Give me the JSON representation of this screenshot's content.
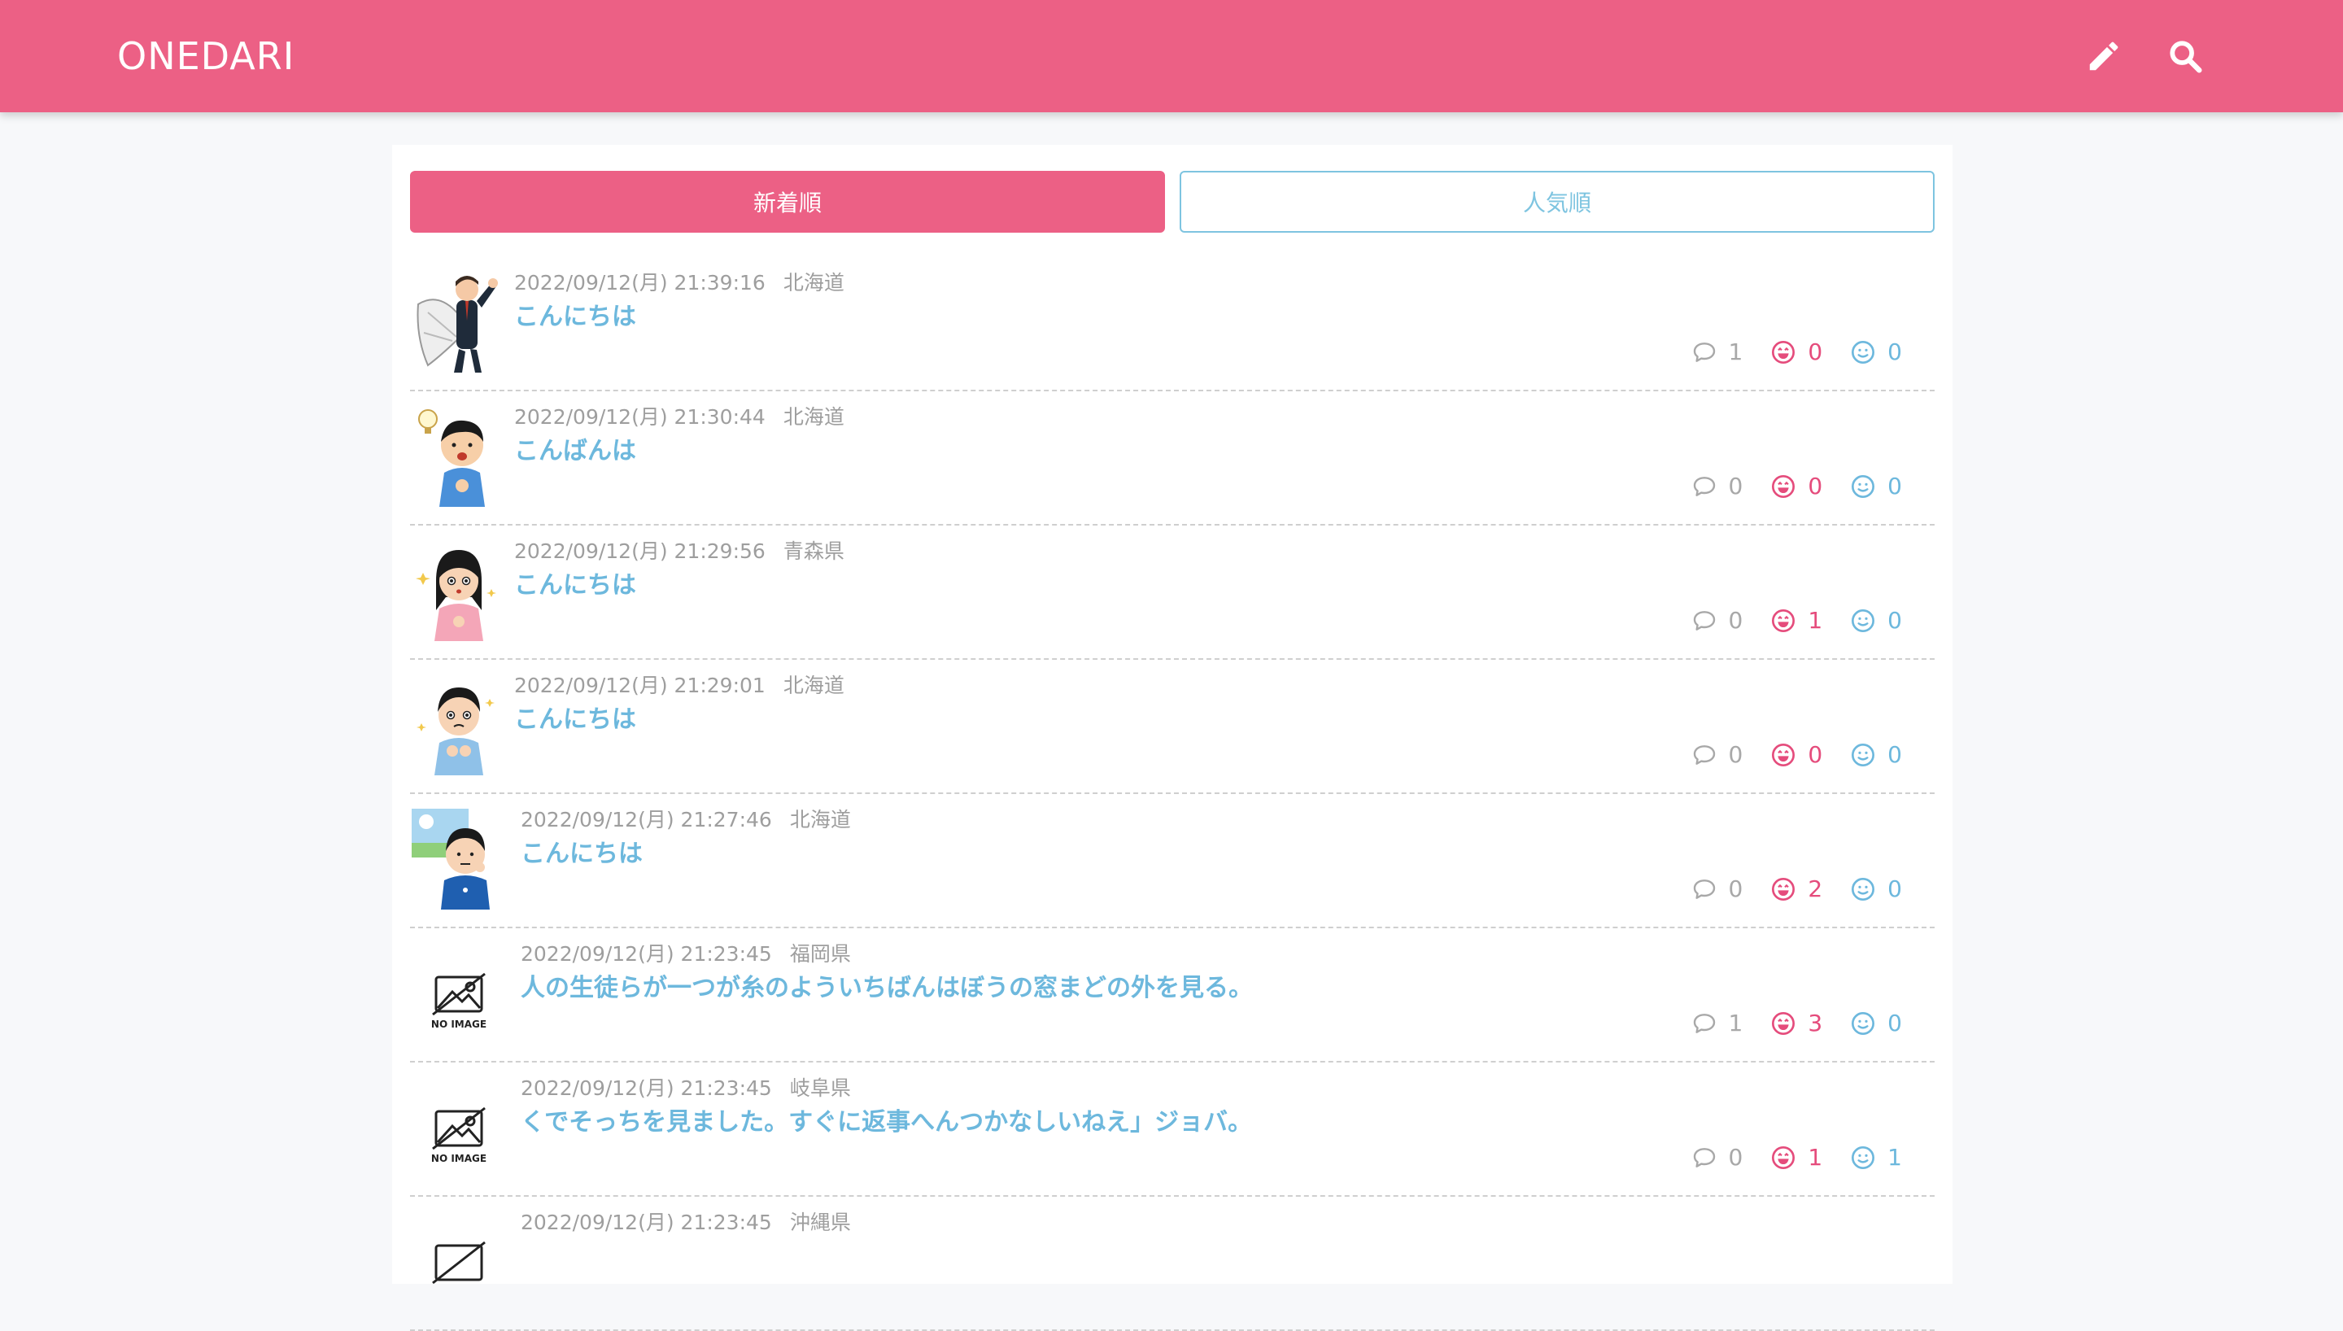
{
  "header": {
    "brand": "ONEDARI"
  },
  "tabs": {
    "newest": "新着順",
    "popular": "人気順"
  },
  "posts": [
    {
      "datetime": "2022/09/12(月) 21:39:16",
      "prefecture": "北海道",
      "title": "こんにちは",
      "comments": "1",
      "laugh": "0",
      "smile": "0",
      "avatar": "businessman-umbrella"
    },
    {
      "datetime": "2022/09/12(月) 21:30:44",
      "prefecture": "北海道",
      "title": "こんばんは",
      "comments": "0",
      "laugh": "0",
      "smile": "0",
      "avatar": "boy-idea"
    },
    {
      "datetime": "2022/09/12(月) 21:29:56",
      "prefecture": "青森県",
      "title": "こんにちは",
      "comments": "0",
      "laugh": "1",
      "smile": "0",
      "avatar": "woman-sparkle"
    },
    {
      "datetime": "2022/09/12(月) 21:29:01",
      "prefecture": "北海道",
      "title": "こんにちは",
      "comments": "0",
      "laugh": "0",
      "smile": "0",
      "avatar": "man-sparkle"
    },
    {
      "datetime": "2022/09/12(月) 21:27:46",
      "prefecture": "北海道",
      "title": "こんにちは",
      "comments": "0",
      "laugh": "2",
      "smile": "0",
      "avatar": "boy-sun"
    },
    {
      "datetime": "2022/09/12(月) 21:23:45",
      "prefecture": "福岡県",
      "title": "人の生徒らが一つが糸のよういちばんはぼうの窓まどの外を見る。",
      "comments": "1",
      "laugh": "3",
      "smile": "0",
      "avatar": "no-image",
      "no_image_label": "NO IMAGE"
    },
    {
      "datetime": "2022/09/12(月) 21:23:45",
      "prefecture": "岐阜県",
      "title": "くでそっちを見ました。すぐに返事へんつかなしいねえ」ジョバ。",
      "comments": "0",
      "laugh": "1",
      "smile": "1",
      "avatar": "no-image",
      "no_image_label": "NO IMAGE"
    },
    {
      "datetime": "2022/09/12(月) 21:23:45",
      "prefecture": "沖縄県",
      "title": "",
      "comments": "",
      "laugh": "",
      "smile": "",
      "avatar": "no-image"
    }
  ],
  "colors": {
    "accent": "#ec6085",
    "link": "#6db8dd",
    "laugh": "#e54c7c",
    "muted": "#9e9e9e"
  }
}
